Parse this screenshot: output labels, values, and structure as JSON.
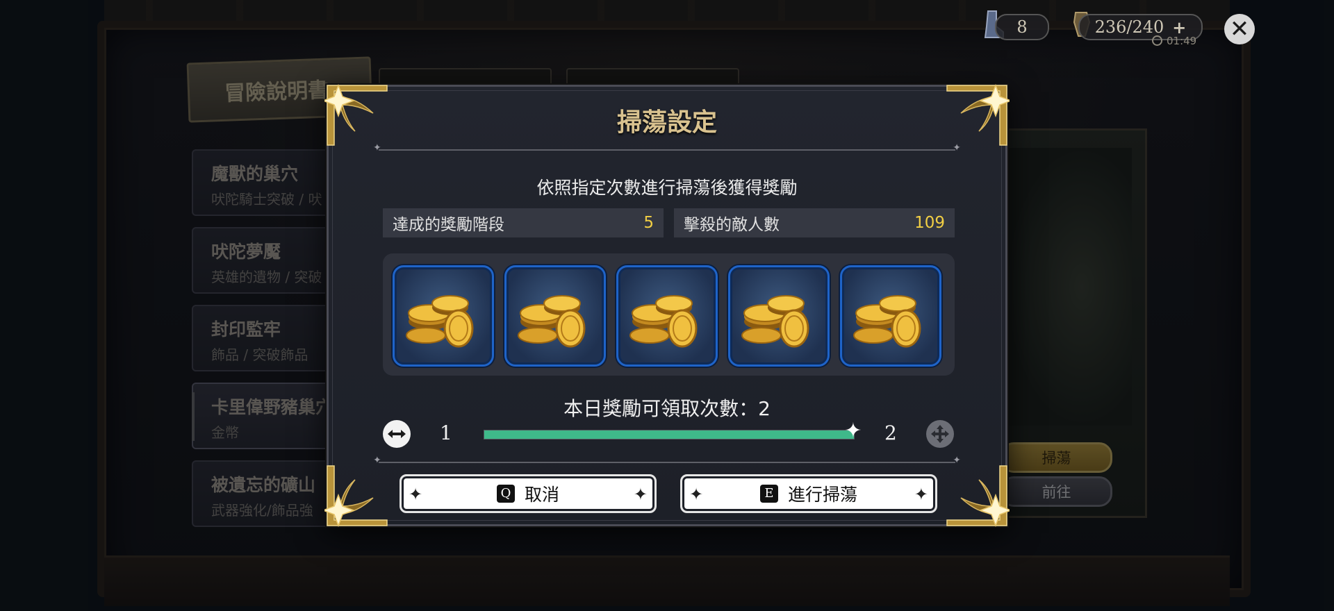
{
  "background": {
    "book_title": "冒險說明書",
    "dungeons": [
      {
        "name": "魔獸的巢穴",
        "sub": "吠陀騎士突破 / 吠"
      },
      {
        "name": "吠陀夢魘",
        "sub": "英雄的遺物 / 突破"
      },
      {
        "name": "封印監牢",
        "sub": "飾品 / 突破飾品"
      },
      {
        "name": "卡里偉野豬巢穴",
        "sub": "金幣"
      },
      {
        "name": "被遺忘的礦山",
        "sub": "武器強化/飾品強"
      }
    ],
    "sweep_button": "掃蕩",
    "goto_button": "前往"
  },
  "hud": {
    "stamina_left": "8",
    "stamina": "236/240",
    "stamina_plus": "+",
    "timer": "01:49",
    "close": "✕"
  },
  "modal": {
    "title": "掃蕩設定",
    "subtitle": "依照指定次數進行掃蕩後獲得獎勵",
    "stats": {
      "reward_stage_label": "達成的獎勵階段",
      "reward_stage_value": "5",
      "kills_label": "擊殺的敵人數",
      "kills_value": "109"
    },
    "rewards": [
      "gold-coins-icon",
      "gold-coins-icon",
      "gold-coins-icon",
      "gold-coins-icon",
      "gold-coins-icon"
    ],
    "daily_claims": "本日獎勵可領取次數：2",
    "slider": {
      "min": "1",
      "max": "2",
      "value": 2
    },
    "cancel": {
      "key": "Q",
      "label": "取消"
    },
    "confirm": {
      "key": "E",
      "label": "進行掃蕩"
    }
  },
  "colors": {
    "accent_gold": "#d9c28f",
    "value_yellow": "#f2cf44",
    "slider_green": "#3fb98a",
    "slot_blue": "#1e63c8"
  }
}
